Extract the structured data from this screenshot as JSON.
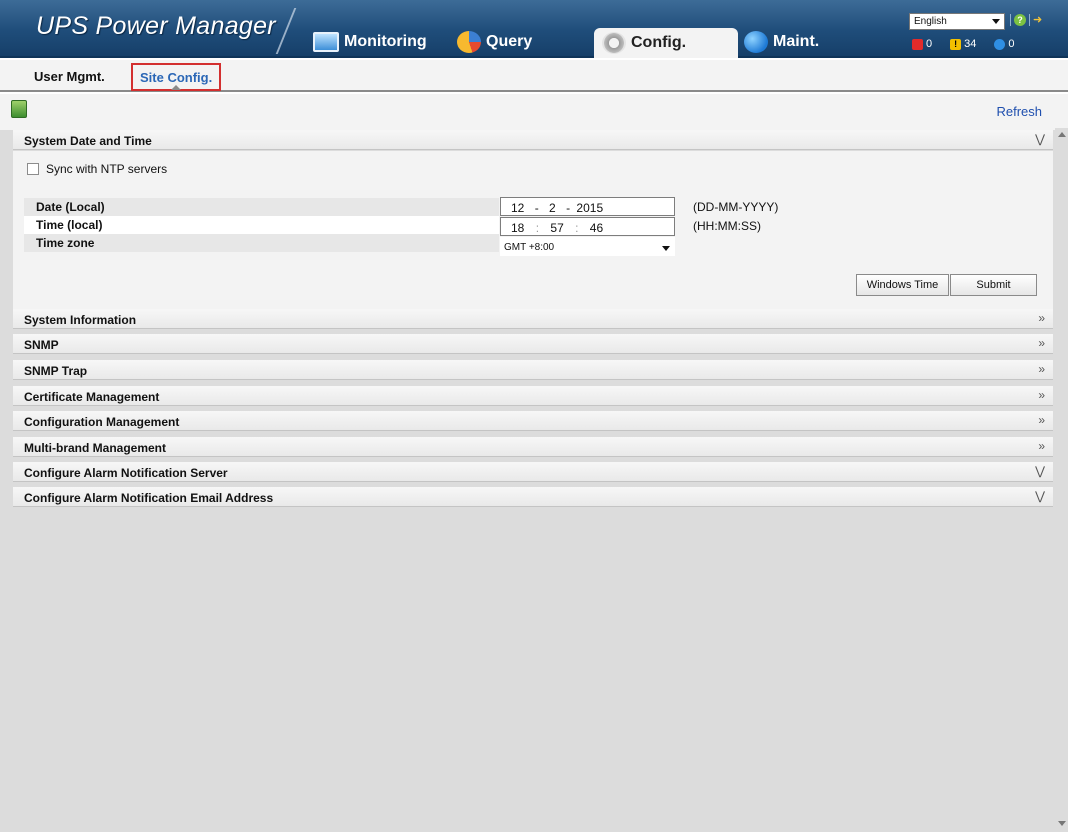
{
  "header": {
    "app_title": "UPS Power Manager",
    "language": "English",
    "alarms": {
      "critical": "0",
      "major": "34",
      "minor": "0"
    }
  },
  "nav": {
    "tabs": [
      {
        "label": "Monitoring",
        "icon": "monitor-icon"
      },
      {
        "label": "Query",
        "icon": "pie-chart-icon"
      },
      {
        "label": "Config.",
        "icon": "gear-icon",
        "active": true
      },
      {
        "label": "Maint.",
        "icon": "globe-icon"
      }
    ]
  },
  "subtabs": {
    "user_mgmt": "User Mgmt.",
    "site_config": "Site Config."
  },
  "toolbar": {
    "refresh_label": "Refresh"
  },
  "datetime": {
    "title": "System Date and Time",
    "sync_label": "Sync with NTP servers",
    "date_label": "Date (Local)",
    "time_label": "Time (local)",
    "timezone_label": "Time zone",
    "date_day": "12",
    "date_month": "2",
    "date_year": "2015",
    "date_sep": "-",
    "time_hour": "18",
    "time_min": "57",
    "time_sec": "46",
    "time_sep": ":",
    "date_format": "(DD-MM-YYYY)",
    "time_format": "(HH:MM:SS)",
    "timezone_value": "GMT +8:00",
    "windows_time_label": "Windows Time",
    "submit_label": "Submit"
  },
  "sections": [
    "System Information",
    "SNMP",
    "SNMP Trap",
    "Certificate Management",
    "Configuration Management",
    "Multi-brand Management",
    "Configure Alarm Notification Server",
    "Configure Alarm Notification Email Address"
  ],
  "colors": {
    "header_bg": "#1f4d7a",
    "link": "#1f4fae",
    "highlight_box": "#d32f2f"
  }
}
